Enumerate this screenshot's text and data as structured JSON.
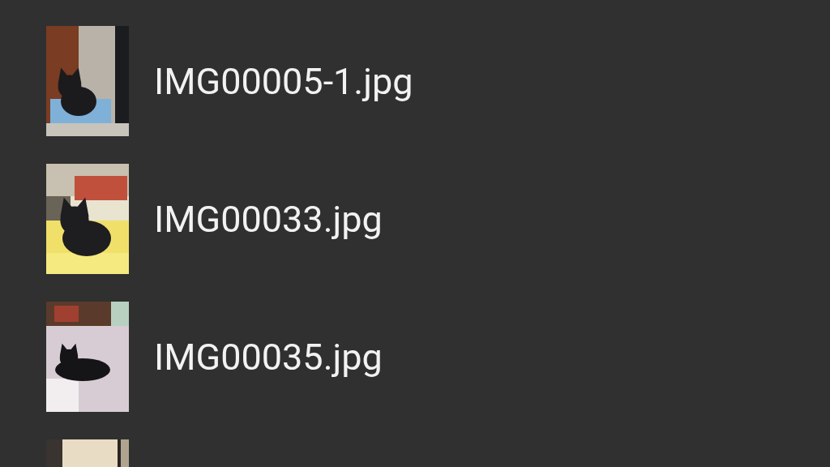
{
  "files": [
    {
      "name": "IMG00005-1.jpg",
      "thumbnail": {
        "kind": "picture"
      }
    },
    {
      "name": "IMG00033.jpg",
      "thumbnail": {
        "kind": "picture"
      }
    },
    {
      "name": "IMG00035.jpg",
      "thumbnail": {
        "kind": "picture"
      }
    },
    {
      "thumbnail": {
        "kind": "picture"
      }
    }
  ]
}
